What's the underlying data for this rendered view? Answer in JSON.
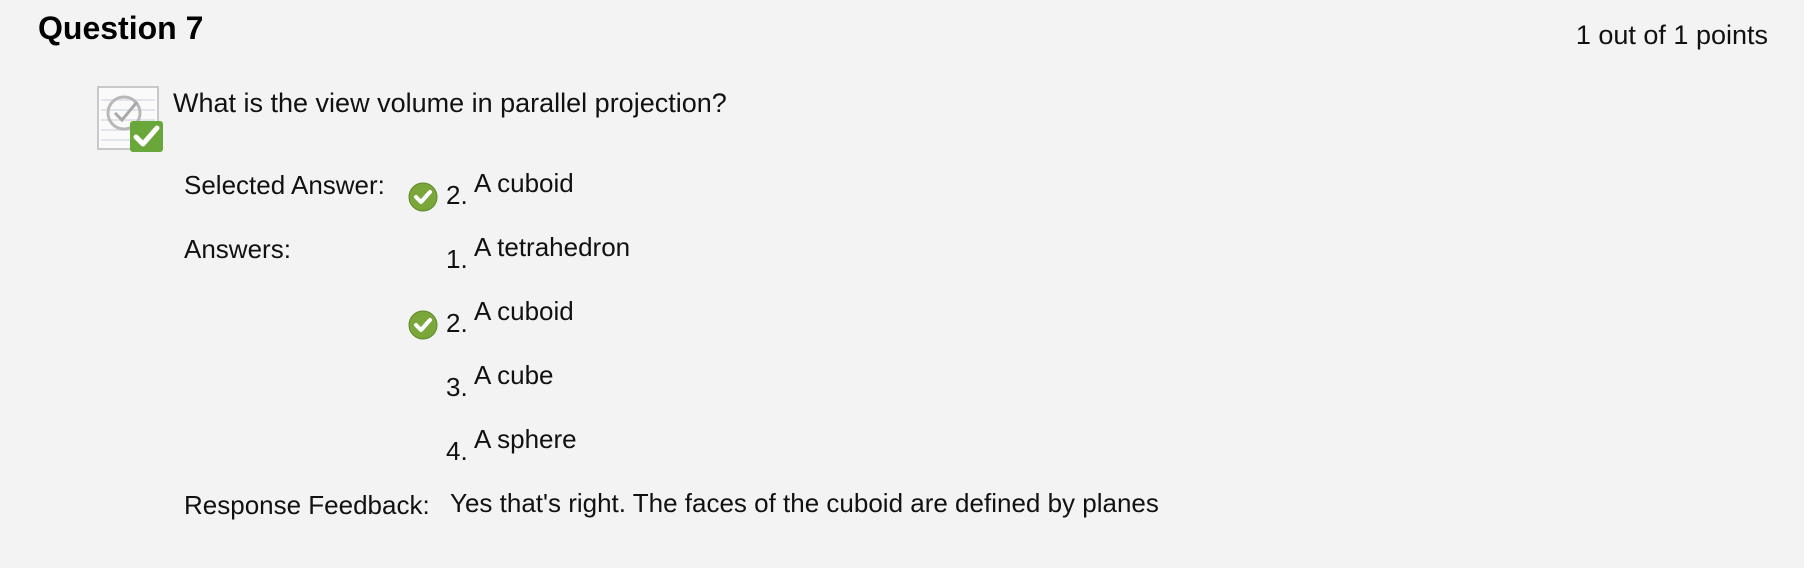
{
  "question": {
    "title": "Question 7",
    "points": "1 out of 1 points",
    "text": "What is the view volume in parallel projection?"
  },
  "labels": {
    "selected": "Selected Answer:",
    "answers": "Answers:",
    "feedback": "Response Feedback:"
  },
  "selected_answer": {
    "number": "2.",
    "text": "A cuboid"
  },
  "answers": [
    {
      "number": "1.",
      "text": "A tetrahedron"
    },
    {
      "number": "2.",
      "text": "A cuboid"
    },
    {
      "number": "3.",
      "text": "A cube"
    },
    {
      "number": "4.",
      "text": "A sphere"
    }
  ],
  "feedback": "Yes that's right. The faces of the cuboid are defined by planes",
  "colors": {
    "background": "#f3f3f3",
    "correct_green": "#7aa63a"
  },
  "icons": {
    "question_status": "correct-question-icon",
    "answer_correct": "check-circle-icon"
  }
}
